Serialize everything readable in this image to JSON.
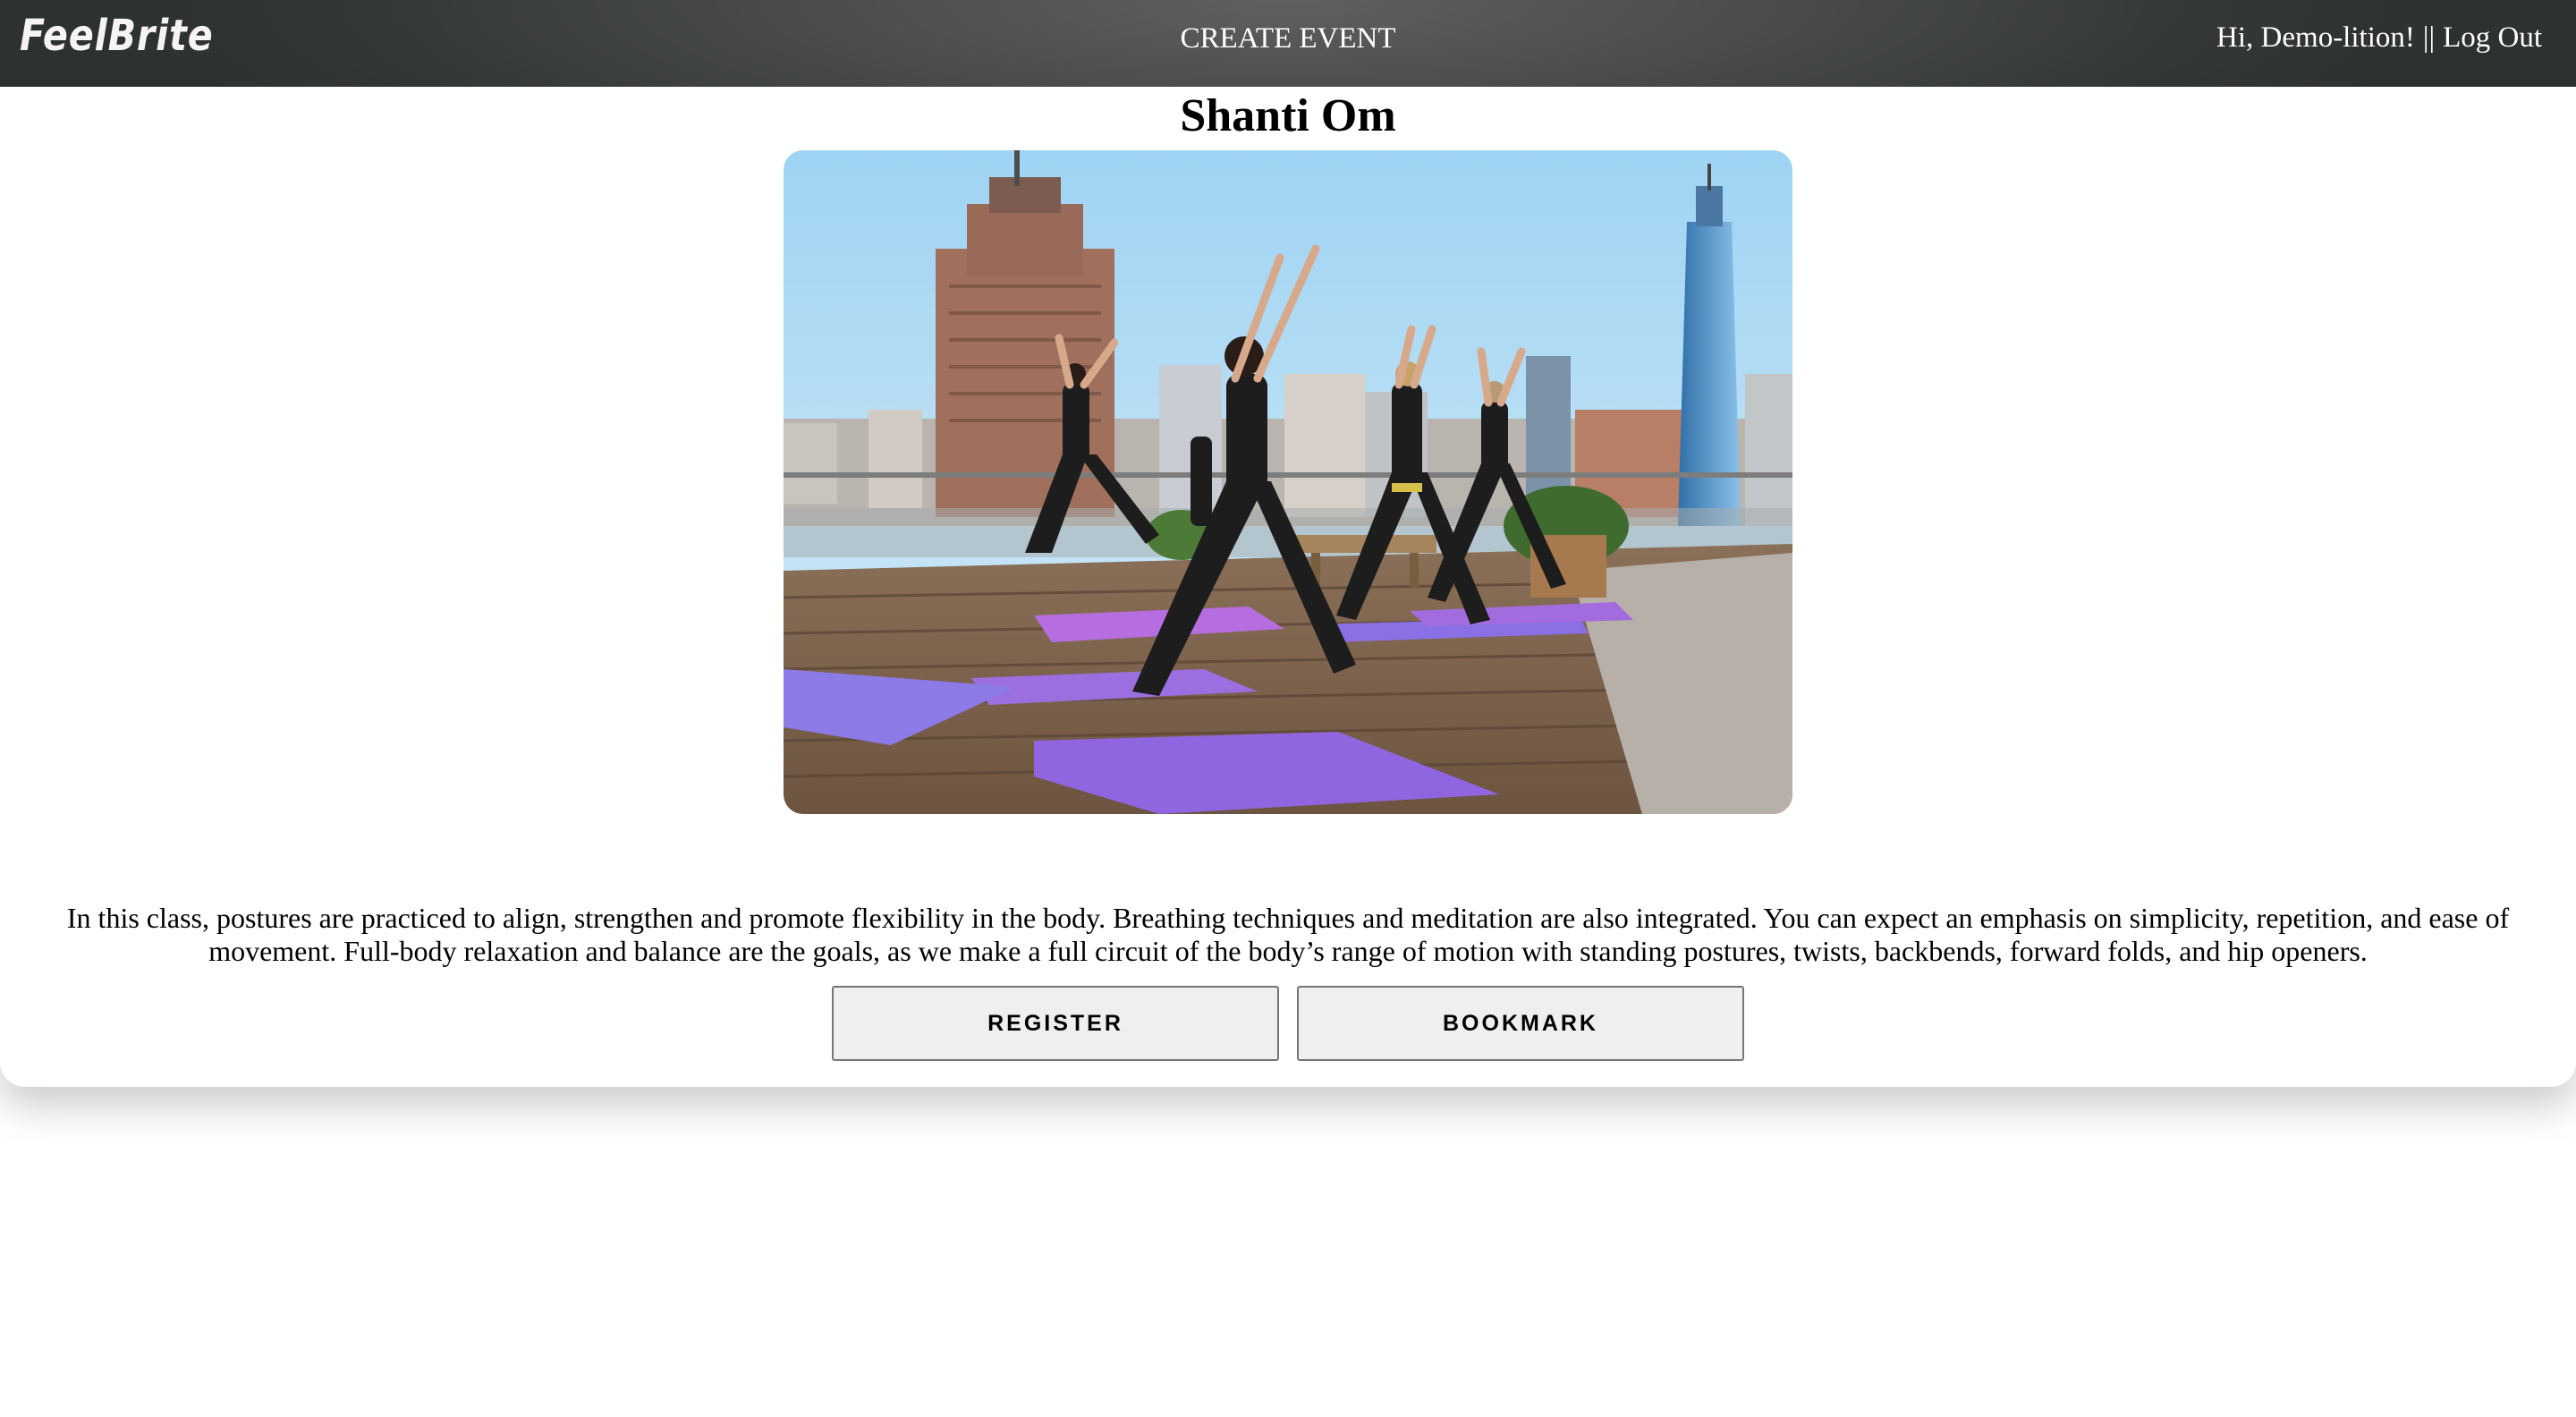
{
  "header": {
    "logo": "FeelBrite",
    "create_event": "CREATE EVENT",
    "greeting": "Hi, Demo-lition!",
    "separator": "||",
    "logout": "Log Out"
  },
  "event": {
    "title": "Shanti Om",
    "image_alt": "yoga-class-on-rooftop-photo",
    "description": "In this class, postures are practiced to align, strengthen and promote flexibility in the body. Breathing techniques and meditation are also integrated. You can expect an emphasis on simplicity, repetition, and ease of movement. Full-body relaxation and balance are the goals, as we make a full circuit of the body’s range of motion with standing postures, twists, backbends, forward folds, and hip openers.",
    "register_label": "REGISTER",
    "bookmark_label": "BOOKMARK"
  },
  "colors": {
    "header_bg": "#3a3d3d",
    "header_text": "#ffffff",
    "button_bg": "#efefef",
    "button_border": "#767676",
    "yoga_mat": "#9b6fe0"
  }
}
